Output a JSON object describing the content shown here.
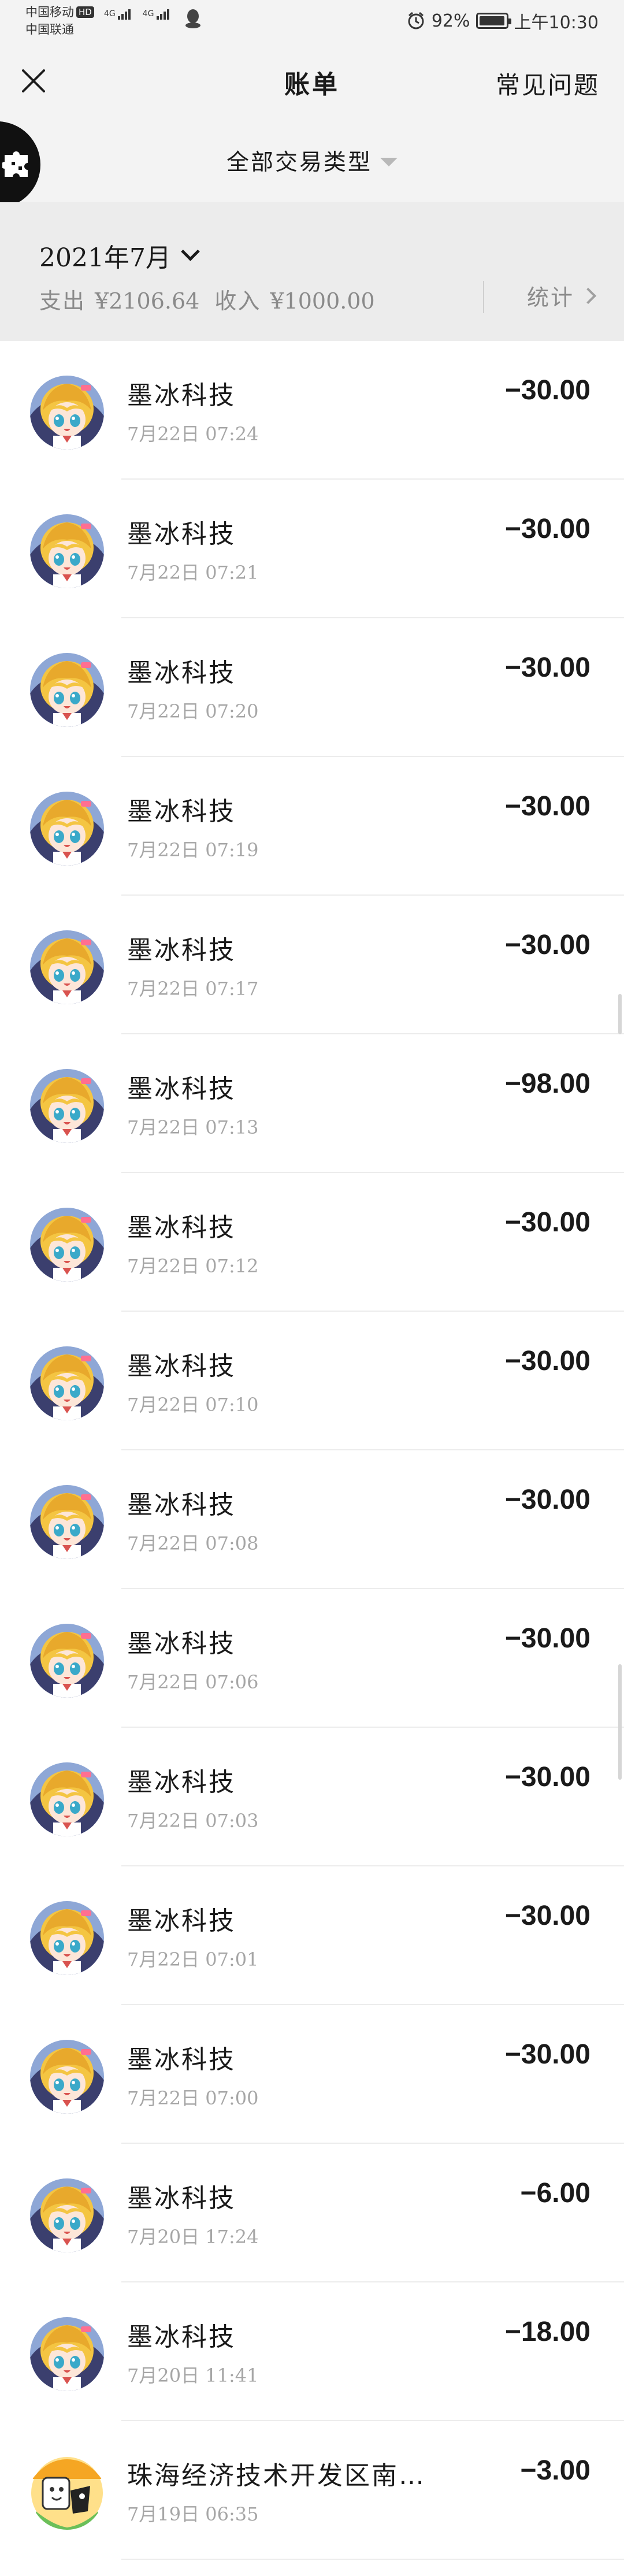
{
  "status_bar": {
    "carrier1": "中国移动",
    "carrier1_badge": "HD",
    "carrier2": "中国联通",
    "net1": "4G",
    "net2": "4G",
    "battery": "92%",
    "time": "上午10:30"
  },
  "header": {
    "title": "账单",
    "faq_label": "常见问题",
    "filter_label": "全部交易类型"
  },
  "summary": {
    "month": "2021年7月",
    "expense_label": "支出",
    "expense_amount": "¥2106.64",
    "income_label": "收入",
    "income_amount": "¥1000.00",
    "stats_label": "统计"
  },
  "transactions": [
    {
      "name": "墨冰科技",
      "time": "7月22日 07:24",
      "amount": "−30.00",
      "avatar": "anime-avatar"
    },
    {
      "name": "墨冰科技",
      "time": "7月22日 07:21",
      "amount": "−30.00",
      "avatar": "anime-avatar"
    },
    {
      "name": "墨冰科技",
      "time": "7月22日 07:20",
      "amount": "−30.00",
      "avatar": "anime-avatar"
    },
    {
      "name": "墨冰科技",
      "time": "7月22日 07:19",
      "amount": "−30.00",
      "avatar": "anime-avatar"
    },
    {
      "name": "墨冰科技",
      "time": "7月22日 07:17",
      "amount": "−30.00",
      "avatar": "anime-avatar"
    },
    {
      "name": "墨冰科技",
      "time": "7月22日 07:13",
      "amount": "−98.00",
      "avatar": "anime-avatar"
    },
    {
      "name": "墨冰科技",
      "time": "7月22日 07:12",
      "amount": "−30.00",
      "avatar": "anime-avatar"
    },
    {
      "name": "墨冰科技",
      "time": "7月22日 07:10",
      "amount": "−30.00",
      "avatar": "anime-avatar"
    },
    {
      "name": "墨冰科技",
      "time": "7月22日 07:08",
      "amount": "−30.00",
      "avatar": "anime-avatar"
    },
    {
      "name": "墨冰科技",
      "time": "7月22日 07:06",
      "amount": "−30.00",
      "avatar": "anime-avatar"
    },
    {
      "name": "墨冰科技",
      "time": "7月22日 07:03",
      "amount": "−30.00",
      "avatar": "anime-avatar"
    },
    {
      "name": "墨冰科技",
      "time": "7月22日 07:01",
      "amount": "−30.00",
      "avatar": "anime-avatar"
    },
    {
      "name": "墨冰科技",
      "time": "7月22日 07:00",
      "amount": "−30.00",
      "avatar": "anime-avatar"
    },
    {
      "name": "墨冰科技",
      "time": "7月20日 17:24",
      "amount": "−6.00",
      "avatar": "anime-avatar"
    },
    {
      "name": "墨冰科技",
      "time": "7月20日 11:41",
      "amount": "−18.00",
      "avatar": "anime-avatar"
    },
    {
      "name": "珠海经济技术开发区南…",
      "time": "7月19日 06:35",
      "amount": "−3.00",
      "avatar": "cartoon-avatar"
    }
  ]
}
